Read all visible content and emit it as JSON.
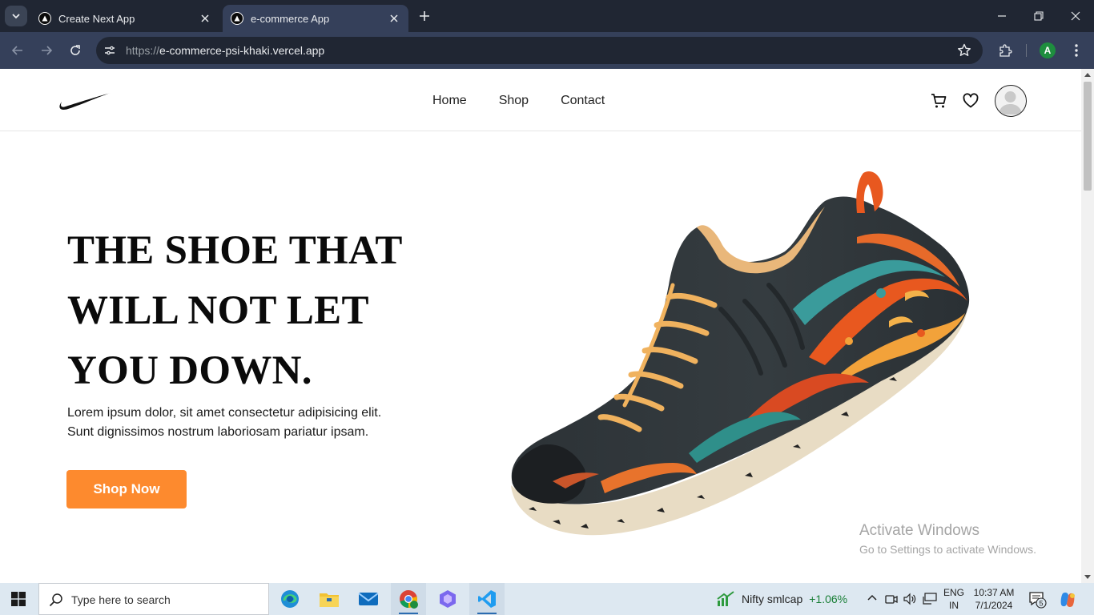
{
  "browser": {
    "tabs": [
      {
        "title": "Create Next App",
        "active": false
      },
      {
        "title": "e-commerce App",
        "active": true
      }
    ],
    "address": {
      "protocol": "https://",
      "host": "e-commerce-psi-khaki.vercel.app"
    },
    "profile_initial": "A"
  },
  "site": {
    "nav": [
      "Home",
      "Shop",
      "Contact"
    ],
    "hero": {
      "heading_lines": [
        "THE SHOE THAT",
        "WILL NOT LET",
        "YOU DOWN."
      ],
      "description": "Lorem ipsum dolor, sit amet consectetur adipisicing elit. Sunt dignissimos nostrum laboriosam pariatur ipsam.",
      "cta": "Shop Now"
    },
    "colors": {
      "cta": "#fd8a2e",
      "text": "#0a0a0a"
    }
  },
  "watermark": {
    "title": "Activate Windows",
    "subtitle": "Go to Settings to activate Windows."
  },
  "taskbar": {
    "search_placeholder": "Type here to search",
    "widget": {
      "name": "Nifty smlcap",
      "change": "+1.06%"
    },
    "lang": [
      "ENG",
      "IN"
    ],
    "time": "10:37 AM",
    "date": "7/1/2024",
    "notification_count": "5"
  }
}
